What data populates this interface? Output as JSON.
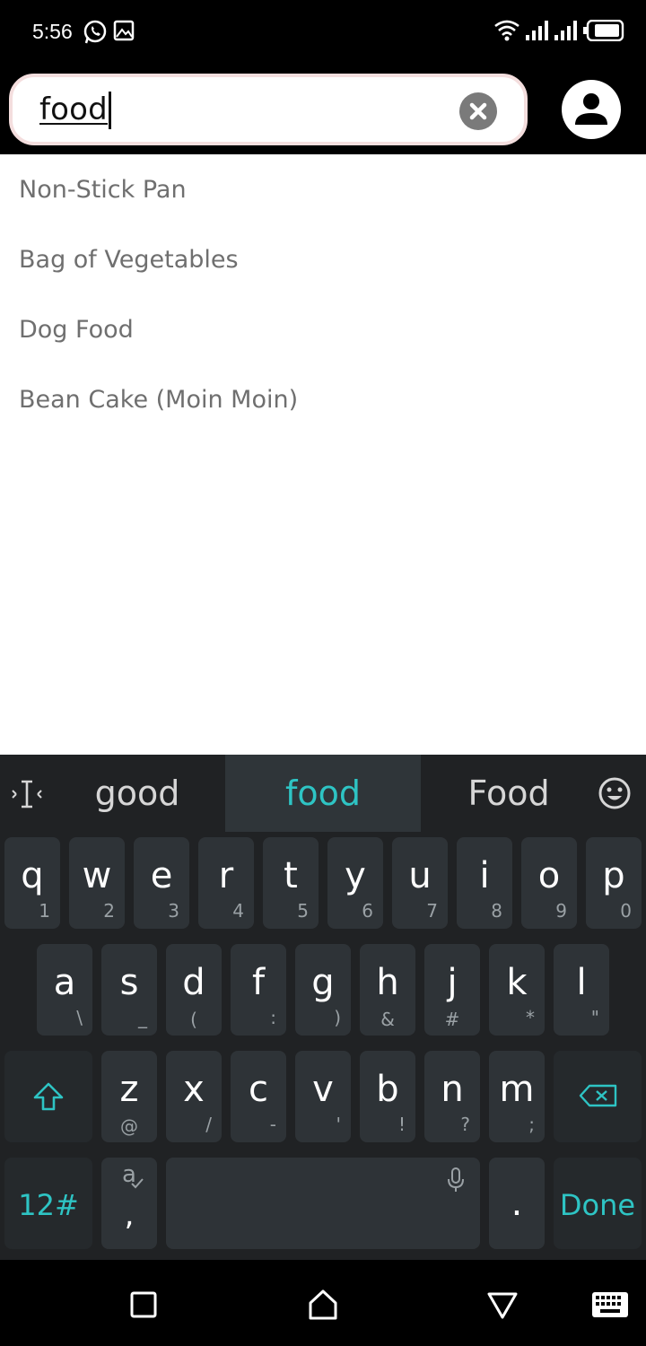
{
  "status_bar": {
    "time": "5:56",
    "icons": [
      "whatsapp-icon",
      "image-icon",
      "wifi-icon",
      "signal-icon",
      "signal-icon",
      "battery-icon"
    ]
  },
  "search": {
    "value": "food",
    "clear_icon": "close-circle-icon",
    "profile_icon": "person-circle-icon"
  },
  "suggestions": [
    {
      "label": "Non-Stick Pan"
    },
    {
      "label": "Bag of Vegetables"
    },
    {
      "label": "Dog Food"
    },
    {
      "label": "Bean Cake (Moin Moin)"
    }
  ],
  "keyboard": {
    "candidates": [
      "good",
      "food",
      "Food"
    ],
    "selected_candidate": "food",
    "row1": [
      {
        "key": "q",
        "sub": "1"
      },
      {
        "key": "w",
        "sub": "2"
      },
      {
        "key": "e",
        "sub": "3"
      },
      {
        "key": "r",
        "sub": "4"
      },
      {
        "key": "t",
        "sub": "5"
      },
      {
        "key": "y",
        "sub": "6"
      },
      {
        "key": "u",
        "sub": "7"
      },
      {
        "key": "i",
        "sub": "8"
      },
      {
        "key": "o",
        "sub": "9"
      },
      {
        "key": "p",
        "sub": "0"
      }
    ],
    "row2": [
      {
        "key": "a",
        "sub": "\\"
      },
      {
        "key": "s",
        "sub": "_"
      },
      {
        "key": "d",
        "sub": "("
      },
      {
        "key": "f",
        "sub": ":"
      },
      {
        "key": "g",
        "sub": ")"
      },
      {
        "key": "h",
        "sub": "&"
      },
      {
        "key": "j",
        "sub": "#"
      },
      {
        "key": "k",
        "sub": "*"
      },
      {
        "key": "l",
        "sub": "\""
      }
    ],
    "row3": [
      {
        "key": "z",
        "sub": "@"
      },
      {
        "key": "x",
        "sub": "/"
      },
      {
        "key": "c",
        "sub": "-"
      },
      {
        "key": "v",
        "sub": "'"
      },
      {
        "key": "b",
        "sub": "!"
      },
      {
        "key": "n",
        "sub": "?"
      },
      {
        "key": "m",
        "sub": ";"
      }
    ],
    "symbols_key": "12#",
    "comma_key": ",",
    "lang_glyph": "a",
    "period_key": ".",
    "done_key": "Done"
  },
  "colors": {
    "accent": "#2ec4c4",
    "keyboard_bg": "#202224",
    "key_bg": "#2e3337",
    "suggestion_text": "#6f6f6f"
  }
}
